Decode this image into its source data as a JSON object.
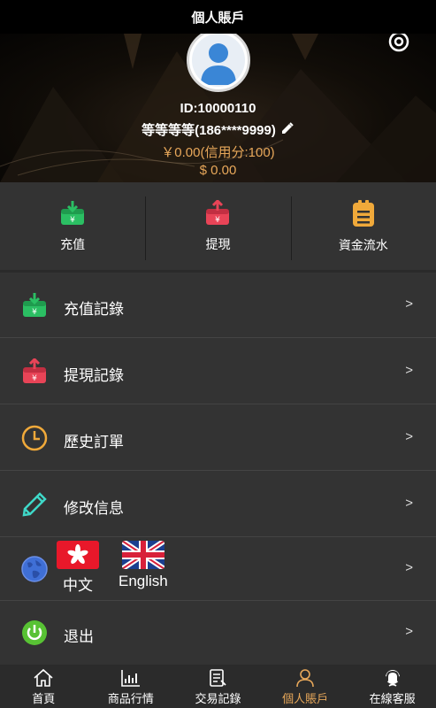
{
  "header": {
    "title": "個人賬戶"
  },
  "profile": {
    "id_text": "ID:10000110",
    "name_text": "等等等等(186****9999)",
    "balance_cny": "￥0.00(信用分:100)",
    "balance_usd": "$ 0.00"
  },
  "actions": [
    {
      "label": "充值",
      "icon": "deposit-icon",
      "color": "#2bbf63"
    },
    {
      "label": "提現",
      "icon": "withdraw-icon",
      "color": "#e84457"
    },
    {
      "label": "資金流水",
      "icon": "ledger-icon",
      "color": "#f0a93a"
    }
  ],
  "menu": {
    "deposit_records": "充值記錄",
    "withdraw_records": "提現記錄",
    "order_history": "歷史訂單",
    "edit_info": "修改信息",
    "lang_zh": "中文",
    "lang_en": "English",
    "logout": "退出",
    "chevron": ">"
  },
  "tabs": [
    {
      "label": "首頁",
      "icon": "home-icon"
    },
    {
      "label": "商品行情",
      "icon": "chart-icon"
    },
    {
      "label": "交易記錄",
      "icon": "records-icon"
    },
    {
      "label": "個人賬戶",
      "icon": "user-icon",
      "active": true
    },
    {
      "label": "在線客服",
      "icon": "support-icon"
    }
  ],
  "colors": {
    "accent": "#e8a85a",
    "green": "#2bbf63",
    "red": "#e84457",
    "orange": "#f0a93a",
    "cyan": "#3fd8c8",
    "power_green": "#58c234"
  }
}
